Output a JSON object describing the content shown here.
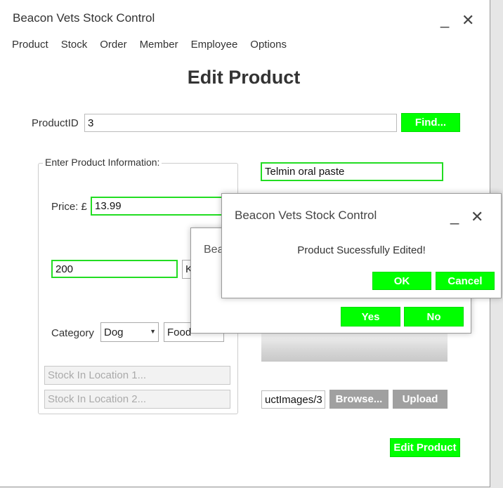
{
  "main": {
    "title": "Beacon Vets Stock Control",
    "minimize": "_",
    "close": "✕",
    "menu": [
      "Product",
      "Stock",
      "Order",
      "Member",
      "Employee",
      "Options"
    ],
    "heading": "Edit Product",
    "product_id_label": "ProductID",
    "product_id_value": "3",
    "find_button": "Find...",
    "group_label": "Enter Product Information:",
    "name_value": "Telmin oral paste",
    "price_label": "Price: £",
    "price_value": "13.99",
    "quantity_value": "200",
    "unit_value": "K",
    "category_label": "Category",
    "category_value": "Dog",
    "subcategory_value": "Food",
    "stock_loc1_placeholder": "Stock In Location 1...",
    "stock_loc2_placeholder": "Stock In Location 2...",
    "image_path_value": "uctImages/3",
    "browse_button": "Browse...",
    "upload_button": "Upload",
    "edit_button": "Edit Product"
  },
  "back_dialog": {
    "title_fragment": "Bea",
    "yes_button": "Yes",
    "no_button": "No"
  },
  "front_dialog": {
    "title": "Beacon Vets Stock Control",
    "minimize": "_",
    "close": "✕",
    "message": "Product Sucessfully Edited!",
    "ok_button": "OK",
    "cancel_button": "Cancel"
  },
  "colors": {
    "accent_green": "#00ff00",
    "field_border_green": "#22dd22",
    "disabled_button_gray": "#a0a0a0"
  }
}
